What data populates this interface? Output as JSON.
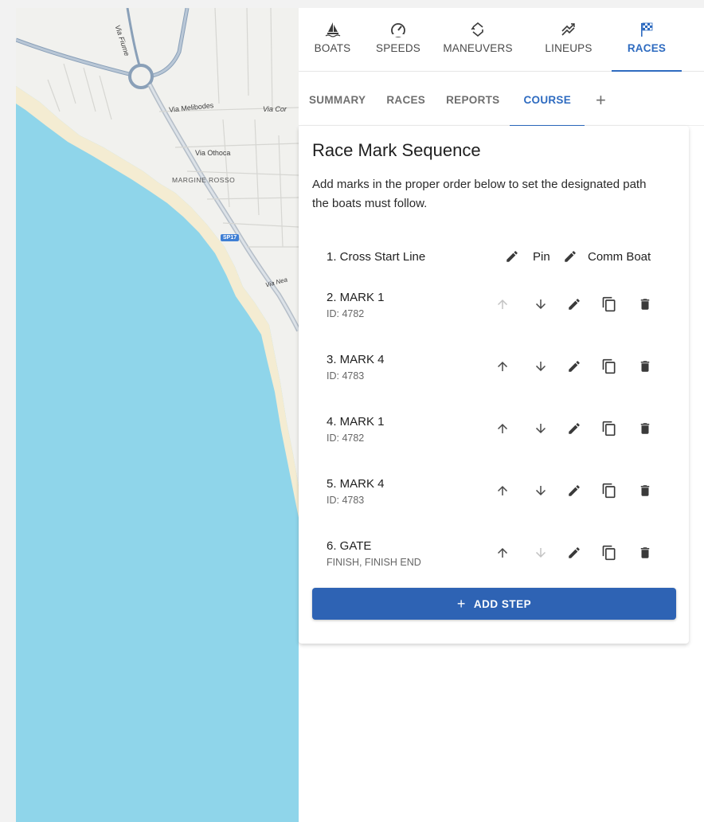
{
  "map": {
    "labels": {
      "via_fiume": "Via Fiume",
      "via_melibodes": "Via Melibodes",
      "via_cor": "Via Cor",
      "via_othoca": "Via Othoca",
      "margine_rosso": "MARGINE ROSSO",
      "sp17": "SP17",
      "via_nea": "Via Nea"
    }
  },
  "nav": {
    "tabs": [
      {
        "label": "BOATS",
        "icon": "sailboat-icon"
      },
      {
        "label": "SPEEDS",
        "icon": "speedometer-icon"
      },
      {
        "label": "MANEUVERS",
        "icon": "tack-arrows-icon"
      },
      {
        "label": "LINEUPS",
        "icon": "lineup-lines-icon"
      },
      {
        "label": "RACES",
        "icon": "checkered-flag-icon"
      }
    ],
    "active": "RACES"
  },
  "subtabs": {
    "tabs": [
      "SUMMARY",
      "RACES",
      "REPORTS",
      "COURSE"
    ],
    "active": "COURSE",
    "add": "+"
  },
  "card": {
    "title": "Race Mark Sequence",
    "description": "Add marks in the proper order below to set the designated path the boats must follow."
  },
  "start_step": {
    "name": "1. Cross Start Line",
    "pin_label": "Pin",
    "comm_label": "Comm Boat"
  },
  "steps": [
    {
      "name": "2. MARK 1",
      "sub": "ID: 4782",
      "up_enabled": false,
      "down_enabled": true
    },
    {
      "name": "3. MARK 4",
      "sub": "ID: 4783",
      "up_enabled": true,
      "down_enabled": true
    },
    {
      "name": "4. MARK 1",
      "sub": "ID: 4782",
      "up_enabled": true,
      "down_enabled": true
    },
    {
      "name": "5. MARK 4",
      "sub": "ID: 4783",
      "up_enabled": true,
      "down_enabled": true
    },
    {
      "name": "6. GATE",
      "sub": "FINISH, FINISH END",
      "up_enabled": true,
      "down_enabled": false
    }
  ],
  "add_step": {
    "plus": "+",
    "label": "ADD STEP"
  },
  "colors": {
    "accent": "#2e6bc0",
    "button": "#2e63b4",
    "water": "#8fd5ea",
    "land": "#f1f1ee",
    "icon_enabled": "#4a4a4a",
    "icon_disabled": "#c4c4c4"
  }
}
